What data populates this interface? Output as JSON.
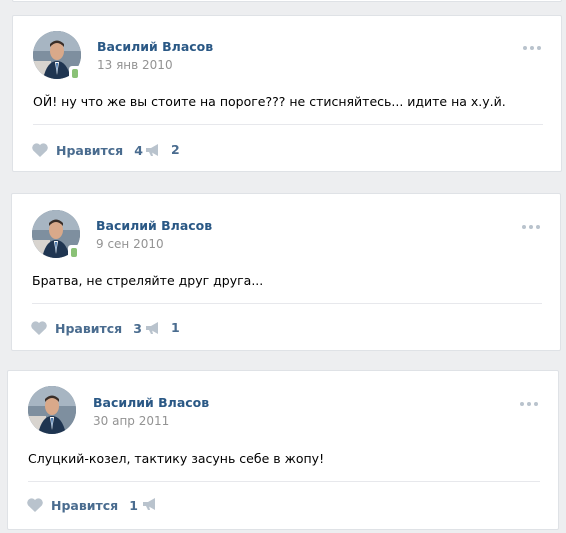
{
  "colors": {
    "background": "#edeef0",
    "author_link": "#2a5885",
    "action_text": "#4a6c8f",
    "icon": "#b9c3cd",
    "online": "#8ac176"
  },
  "icons": {
    "like": "heart-icon",
    "share": "megaphone-icon",
    "more": "more-dots-icon"
  },
  "like_label": "Нравится",
  "posts": [
    {
      "author": "Василий Власов",
      "date": "13 янв 2010",
      "text": "ОЙ! ну что же вы стоите на пороге??? не стисняйтесь... идите на х.у.й.",
      "likes": "4",
      "shares": "2",
      "online_mobile": true
    },
    {
      "author": "Василий Власов",
      "date": "9 сен 2010",
      "text": "Братва, не стреляйте друг друга...",
      "likes": "3",
      "shares": "1",
      "online_mobile": true
    },
    {
      "author": "Василий Власов",
      "date": "30 апр 2011",
      "text": "Слуцкий-козел, тактику засунь себе в жопу!",
      "likes": "1",
      "shares": "",
      "online_mobile": false
    }
  ]
}
